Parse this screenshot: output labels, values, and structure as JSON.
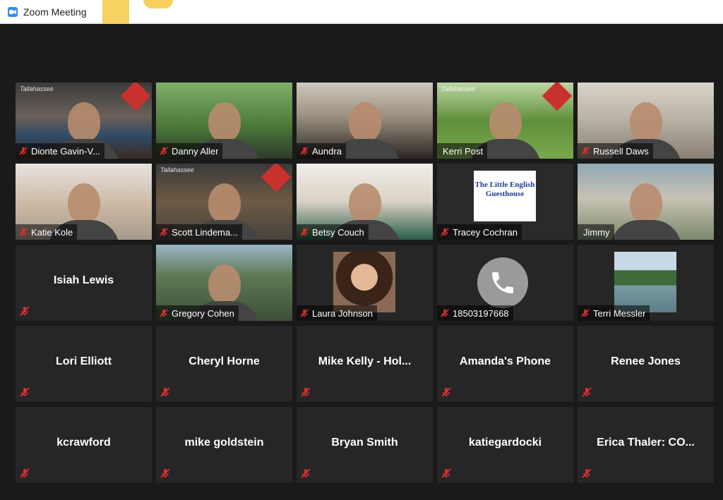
{
  "window": {
    "title": "Zoom Meeting"
  },
  "participants": [
    {
      "name": "Dionte Gavin-V...",
      "muted": true,
      "video": true,
      "logo": "Tallahassee"
    },
    {
      "name": "Danny Aller",
      "muted": true,
      "video": true
    },
    {
      "name": "Aundra",
      "muted": true,
      "video": true
    },
    {
      "name": "Kerri Post",
      "muted": false,
      "video": true,
      "logo": "Tallahassee"
    },
    {
      "name": "Russell Daws",
      "muted": true,
      "video": true
    },
    {
      "name": "Katie Kole",
      "muted": true,
      "video": true
    },
    {
      "name": "Scott Lindema...",
      "muted": true,
      "video": true,
      "logo": "Tallahassee"
    },
    {
      "name": "Betsy Couch",
      "muted": true,
      "video": true
    },
    {
      "name": "Tracey Cochran",
      "muted": true,
      "video": true,
      "logo_text": "The Little English Guesthouse"
    },
    {
      "name": "Jimmy",
      "muted": false,
      "video": true,
      "active_speaker": true
    },
    {
      "name": "Isiah Lewis",
      "muted": true,
      "video": false
    },
    {
      "name": "Gregory Cohen",
      "muted": true,
      "video": true
    },
    {
      "name": "Laura Johnson",
      "muted": true,
      "video": false,
      "avatar": "photo"
    },
    {
      "name": "18503197668",
      "muted": true,
      "video": false,
      "avatar": "phone"
    },
    {
      "name": "Terri Messler",
      "muted": true,
      "video": false,
      "avatar": "landscape"
    },
    {
      "name": "Lori Elliott",
      "muted": true,
      "video": false
    },
    {
      "name": "Cheryl Horne",
      "muted": true,
      "video": false
    },
    {
      "name": "Mike Kelly - Hol...",
      "muted": true,
      "video": false
    },
    {
      "name": "Amanda's Phone",
      "muted": true,
      "video": false
    },
    {
      "name": "Renee Jones",
      "muted": true,
      "video": false
    },
    {
      "name": "kcrawford",
      "muted": true,
      "video": false
    },
    {
      "name": "mike goldstein",
      "muted": true,
      "video": false
    },
    {
      "name": "Bryan Smith",
      "muted": true,
      "video": false
    },
    {
      "name": "katiegardocki",
      "muted": true,
      "video": false
    },
    {
      "name": "Erica Thaler: CO...",
      "muted": true,
      "video": false
    }
  ],
  "colors": {
    "background": "#1a1a1a",
    "tile": "#262626",
    "active_border": "#e5ec7a",
    "muted_icon": "#e02f2f",
    "zoom_blue": "#2d8cff"
  },
  "icons": {
    "muted": "mic-muted-icon",
    "phone": "phone-icon",
    "app": "zoom-icon"
  }
}
